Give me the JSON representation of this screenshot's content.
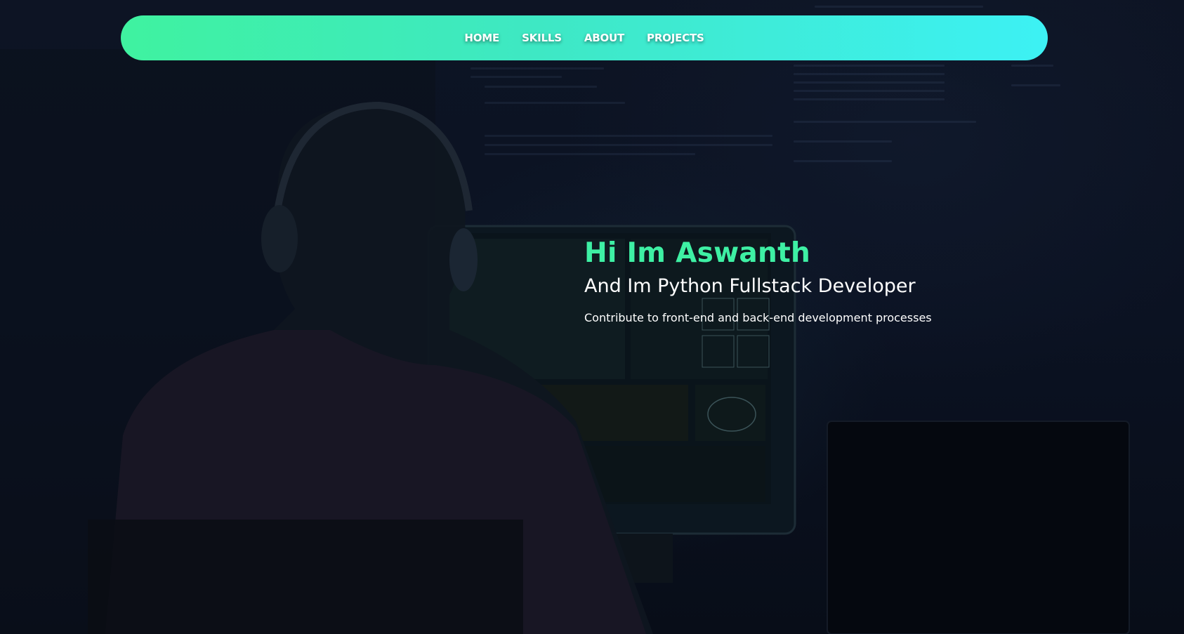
{
  "nav": {
    "items": [
      {
        "label": "HOME"
      },
      {
        "label": "SKILLS"
      },
      {
        "label": "ABOUT"
      },
      {
        "label": "PROJECTS"
      }
    ]
  },
  "hero": {
    "greeting": "Hi Im Aswanth",
    "role": "And Im Python Fullstack Developer",
    "description": "Contribute to front-end and back-end development processes"
  },
  "colors": {
    "accent_green": "#3ef0a4",
    "nav_gradient_start": "#3ff2a0",
    "nav_gradient_end": "#3df1f4",
    "background": "#0a1120"
  }
}
